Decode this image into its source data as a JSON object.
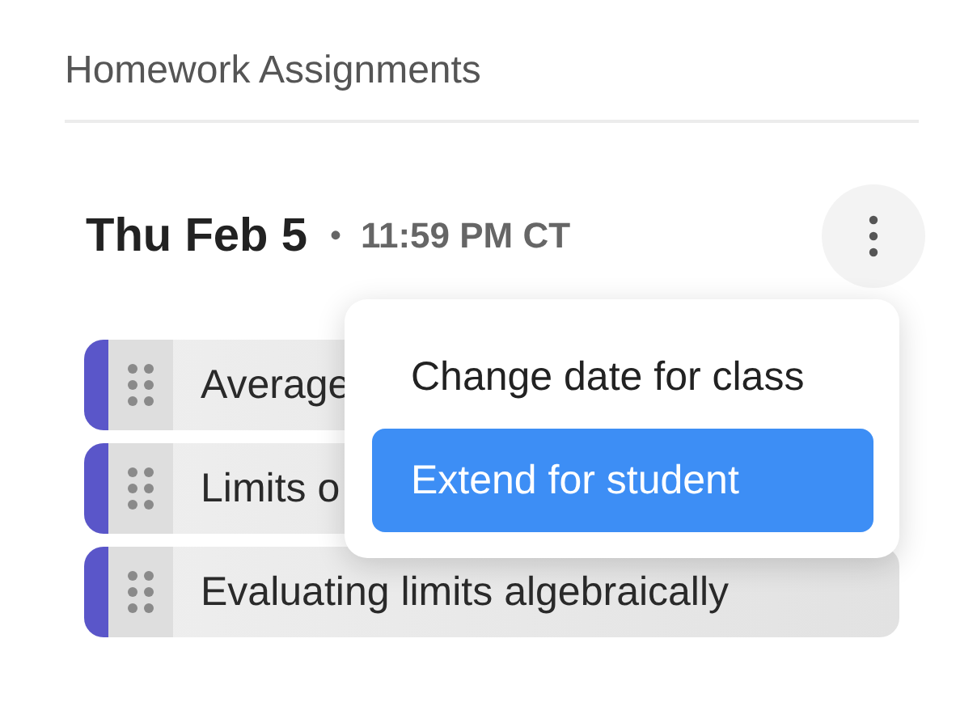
{
  "section_title": "Homework Assignments",
  "due": {
    "date": "Thu Feb 5",
    "separator": "•",
    "time": "11:59 PM CT"
  },
  "assignments": [
    {
      "title": "Average",
      "color": "#5a56c9"
    },
    {
      "title": "Limits o",
      "color": "#5a56c9"
    },
    {
      "title": "Evaluating limits algebraically",
      "color": "#5a56c9"
    }
  ],
  "menu": {
    "open": true,
    "items": [
      {
        "label": "Change date for class",
        "selected": false
      },
      {
        "label": "Extend for student",
        "selected": true
      }
    ]
  }
}
